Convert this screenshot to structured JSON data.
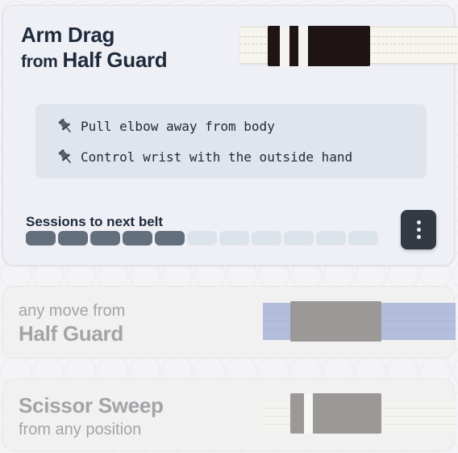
{
  "main_card": {
    "move": "Arm Drag",
    "from_word": "from",
    "position": "Half Guard",
    "belt_color": "#1e1414",
    "tips": [
      {
        "icon": "pushpin-icon",
        "text": "Pull elbow away from body"
      },
      {
        "icon": "pushpin-icon",
        "text": "Control wrist with the outside hand"
      }
    ],
    "sessions_label": "Sessions to next belt",
    "sessions_completed": 5,
    "sessions_total": 11,
    "menu_icon": "kebab-menu-icon"
  },
  "cards": [
    {
      "line1": "any move from",
      "line2": "Half Guard",
      "belt_color": "#b3bedc"
    },
    {
      "line1": "Scissor Sweep",
      "line2": "from any position",
      "belt_color": "#f3f3ef"
    }
  ]
}
